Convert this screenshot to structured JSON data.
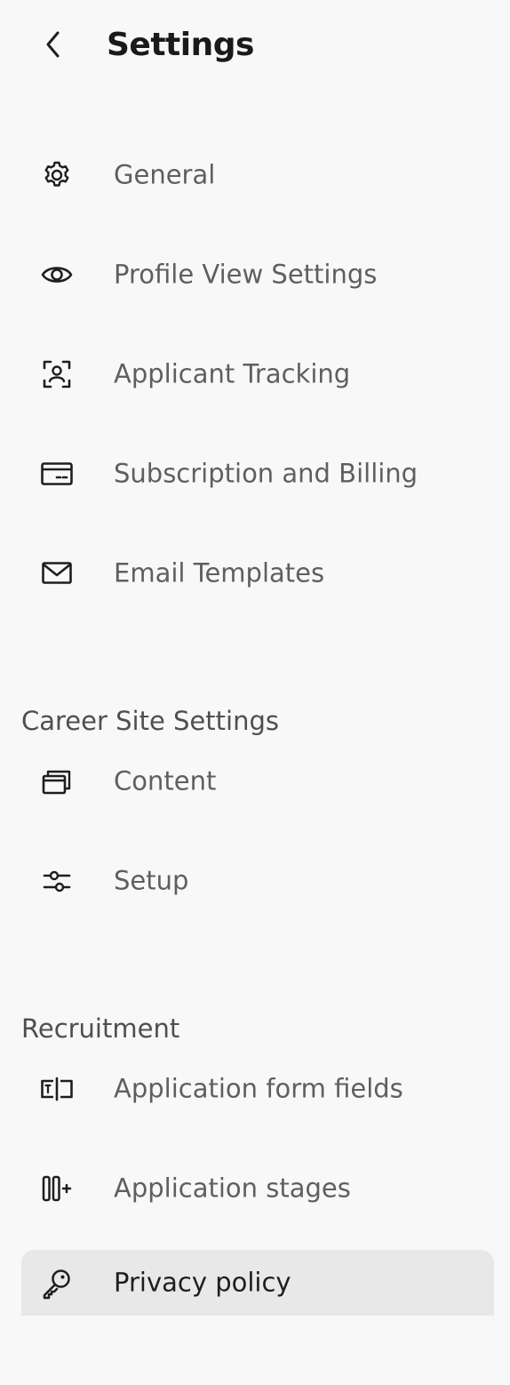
{
  "header": {
    "back_icon": "chevron-left-icon",
    "title": "Settings"
  },
  "general_section": {
    "items": [
      {
        "label": "General",
        "icon": "gear-icon"
      },
      {
        "label": "Profile View Settings",
        "icon": "eye-icon"
      },
      {
        "label": "Applicant Tracking",
        "icon": "user-scan-icon"
      },
      {
        "label": "Subscription and Billing",
        "icon": "credit-card-icon"
      },
      {
        "label": "Email Templates",
        "icon": "envelope-icon"
      }
    ]
  },
  "career_site_section": {
    "heading": "Career Site Settings",
    "items": [
      {
        "label": "Content",
        "icon": "stacked-windows-icon"
      },
      {
        "label": "Setup",
        "icon": "sliders-icon"
      }
    ]
  },
  "recruitment_section": {
    "heading": "Recruitment",
    "items": [
      {
        "label": "Application form fields",
        "icon": "text-field-icon"
      },
      {
        "label": "Application stages",
        "icon": "columns-add-icon"
      },
      {
        "label": "Privacy policy",
        "icon": "key-icon",
        "active": true
      }
    ]
  },
  "colors": {
    "background": "#f8f8f8",
    "active_item_background": "#e8e8e8",
    "label_text": "#5f5f5f",
    "active_label_text": "#1e1e1e"
  }
}
